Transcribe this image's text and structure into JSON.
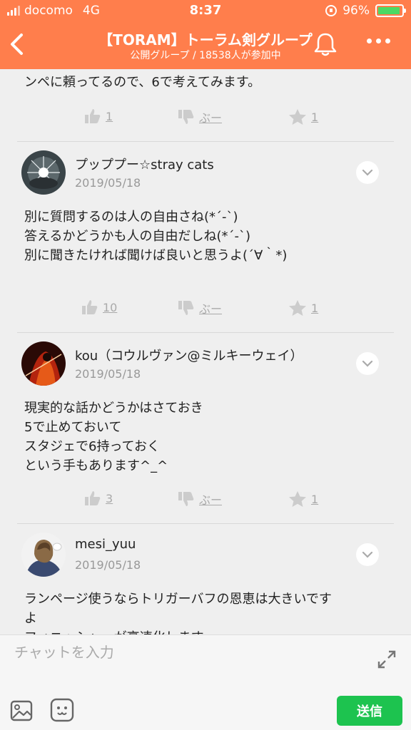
{
  "status_bar": {
    "carrier": "docomo",
    "network": "4G",
    "time": "8:37",
    "battery": "96%"
  },
  "header": {
    "title": "【TORAM】トーラム剣グループ",
    "subtitle": "公開グループ / 18538人が参加中"
  },
  "partial_message": "ンペに頼ってるので、6で考えてみます。",
  "reaction_bars": [
    {
      "like": "1",
      "dislike": "ぶー",
      "star": "1"
    },
    {
      "like": "10",
      "dislike": "ぶー",
      "star": "1"
    },
    {
      "like": "3",
      "dislike": "ぶー",
      "star": "1"
    }
  ],
  "posts": [
    {
      "author": "プッププー☆stray cats",
      "date": "2019/05/18",
      "text": "別に質問するのは人の自由さね(*´-`)\n答えるかどうかも人の自由だしね(*´-`)\n別に聞きたければ聞けば良いと思うよ(´∀｀*)"
    },
    {
      "author": "kou（コウルヴァン@ミルキーウェイ）",
      "date": "2019/05/18",
      "text": "現実的な話かどうかはさておき\n5で止めておいて\nスタジェで6持っておく\nという手もあります^_^"
    },
    {
      "author": "mesi_yuu",
      "date": "2019/05/18",
      "text": "ランページ使うならトリガーバフの恩恵は大きいです\nよ\nフィニッシャーが高速化します"
    }
  ],
  "footer": {
    "input_placeholder": "チャットを入力",
    "send_label": "送信"
  },
  "colors": {
    "header": "#ff7e4c",
    "send": "#1dc34f",
    "battery": "#4cd964"
  }
}
